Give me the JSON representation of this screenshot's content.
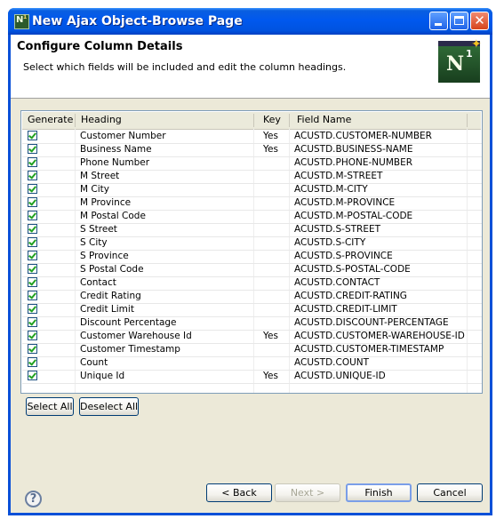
{
  "window": {
    "title": "New Ajax Object-Browse Page"
  },
  "header": {
    "title": "Configure Column Details",
    "description": "Select which fields will be included and edit the column headings.",
    "logo_text": "N",
    "logo_superscript": "1"
  },
  "table": {
    "columns": [
      "Generate",
      "Heading",
      "Key",
      "Field Name"
    ],
    "rows": [
      {
        "generate": true,
        "heading": "Customer Number",
        "key": "Yes",
        "field": "ACUSTD.CUSTOMER-NUMBER"
      },
      {
        "generate": true,
        "heading": "Business Name",
        "key": "Yes",
        "field": "ACUSTD.BUSINESS-NAME"
      },
      {
        "generate": true,
        "heading": "Phone Number",
        "key": "",
        "field": "ACUSTD.PHONE-NUMBER"
      },
      {
        "generate": true,
        "heading": "M Street",
        "key": "",
        "field": "ACUSTD.M-STREET"
      },
      {
        "generate": true,
        "heading": "M City",
        "key": "",
        "field": "ACUSTD.M-CITY"
      },
      {
        "generate": true,
        "heading": "M Province",
        "key": "",
        "field": "ACUSTD.M-PROVINCE"
      },
      {
        "generate": true,
        "heading": "M Postal Code",
        "key": "",
        "field": "ACUSTD.M-POSTAL-CODE"
      },
      {
        "generate": true,
        "heading": "S Street",
        "key": "",
        "field": "ACUSTD.S-STREET"
      },
      {
        "generate": true,
        "heading": "S City",
        "key": "",
        "field": "ACUSTD.S-CITY"
      },
      {
        "generate": true,
        "heading": "S Province",
        "key": "",
        "field": "ACUSTD.S-PROVINCE"
      },
      {
        "generate": true,
        "heading": "S Postal Code",
        "key": "",
        "field": "ACUSTD.S-POSTAL-CODE"
      },
      {
        "generate": true,
        "heading": "Contact",
        "key": "",
        "field": "ACUSTD.CONTACT"
      },
      {
        "generate": true,
        "heading": "Credit Rating",
        "key": "",
        "field": "ACUSTD.CREDIT-RATING"
      },
      {
        "generate": true,
        "heading": "Credit Limit",
        "key": "",
        "field": "ACUSTD.CREDIT-LIMIT"
      },
      {
        "generate": true,
        "heading": "Discount Percentage",
        "key": "",
        "field": "ACUSTD.DISCOUNT-PERCENTAGE"
      },
      {
        "generate": true,
        "heading": "Customer Warehouse Id",
        "key": "Yes",
        "field": "ACUSTD.CUSTOMER-WAREHOUSE-ID"
      },
      {
        "generate": true,
        "heading": "Customer Timestamp",
        "key": "",
        "field": "ACUSTD.CUSTOMER-TIMESTAMP"
      },
      {
        "generate": true,
        "heading": "Count",
        "key": "",
        "field": "ACUSTD.COUNT"
      },
      {
        "generate": true,
        "heading": "Unique Id",
        "key": "Yes",
        "field": "ACUSTD.UNIQUE-ID"
      }
    ]
  },
  "selection_buttons": {
    "select_all": "Select All",
    "deselect_all": "Deselect All"
  },
  "footer": {
    "help_glyph": "?",
    "back": "< Back",
    "next": "Next >",
    "finish": "Finish",
    "cancel": "Cancel"
  },
  "colors": {
    "titlebar": "#0058ee",
    "dialog_bg": "#ece9d8",
    "check": "#21a121"
  }
}
